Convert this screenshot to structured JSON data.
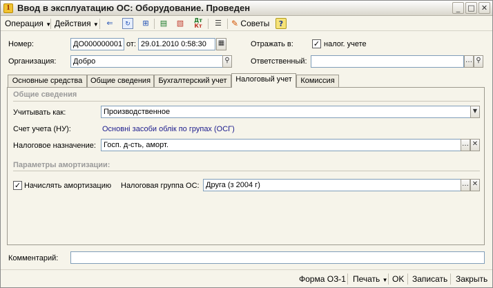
{
  "window": {
    "title": "Ввод в эксплуатацию ОС: Оборудование. Проведен",
    "icon": "1c-document-icon",
    "buttons": {
      "minimize": "_",
      "maximize": "□",
      "close": "✕"
    }
  },
  "toolbar": {
    "operation": "Операция",
    "actions": "Действия",
    "advice": "Советы",
    "help": "?",
    "dt_kt_top": "Дт",
    "dt_kt_bottom": "Кт"
  },
  "header": {
    "number_label": "Номер:",
    "number_value": "ДО000000001",
    "date_label": "от:",
    "date_value": "29.01.2010 0:58:30",
    "reflect_label": "Отражать в:",
    "tax_accounting_label": "налог. учете",
    "tax_accounting_checked": true,
    "org_label": "Организация:",
    "org_value": "Добро",
    "responsible_label": "Ответственный:",
    "responsible_value": ""
  },
  "tabs": [
    {
      "label": "Основные средства",
      "active": false
    },
    {
      "label": "Общие сведения",
      "active": false
    },
    {
      "label": "Бухгалтерский учет",
      "active": false
    },
    {
      "label": "Налоговый учет",
      "active": true
    },
    {
      "label": "Комиссия",
      "active": false
    }
  ],
  "tax_tab": {
    "general_title": "Общие сведения",
    "account_as_label": "Учитывать как:",
    "account_as_value": "Производственное",
    "account_label": "Счет учета (НУ):",
    "account_value": "Основні засоби облік по групах  (ОСГ)",
    "tax_purpose_label": "Налоговое назначение:",
    "tax_purpose_value": "Госп. д-сть, аморт.",
    "depr_title": "Параметры амортизации:",
    "accrue_label": "Начислять амортизацию",
    "accrue_checked": true,
    "tax_group_label": "Налоговая группа ОС:",
    "tax_group_value": "Друга (з 2004 г)"
  },
  "footer": {
    "comment_label": "Комментарий:",
    "comment_value": "",
    "form_button": "Форма ОЗ-1",
    "print_button": "Печать",
    "ok_button": "OK",
    "save_button": "Записать",
    "close_button": "Закрыть"
  },
  "colors": {
    "window_bg": "#f6f4ea",
    "link_text": "#1a1a8c",
    "section_title": "#9a9a9a",
    "field_border": "#7f9db9"
  }
}
